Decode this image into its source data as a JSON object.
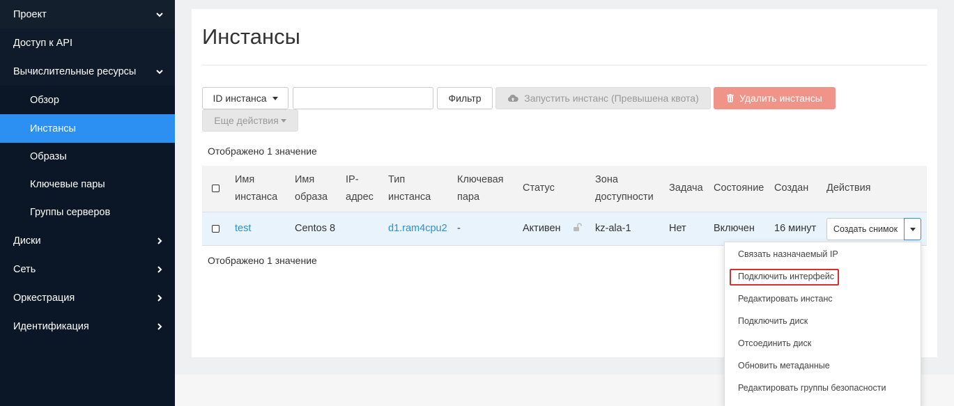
{
  "sidebar": {
    "items": [
      {
        "label": "Проект",
        "chevron": "down"
      },
      {
        "label": "Доступ к API"
      },
      {
        "label": "Вычислительные ресурсы",
        "chevron": "down"
      },
      {
        "label": "Обзор"
      },
      {
        "label": "Инстансы",
        "active": true
      },
      {
        "label": "Образы"
      },
      {
        "label": "Ключевые пары"
      },
      {
        "label": "Группы серверов"
      },
      {
        "label": "Диски",
        "chevron": "right"
      },
      {
        "label": "Сеть",
        "chevron": "right"
      },
      {
        "label": "Оркестрация",
        "chevron": "right"
      },
      {
        "label": "Идентификация",
        "chevron": "right"
      }
    ]
  },
  "page": {
    "title": "Инстансы"
  },
  "toolbar": {
    "filter_field": "ID инстанса",
    "filter_input_value": "",
    "filter_button": "Фильтр",
    "launch_button": "Запустить инстанс (Превышена квота)",
    "delete_button": "Удалить инстансы",
    "more_actions": "Еще действия",
    "launch_icon": "cloud-upload-icon",
    "delete_icon": "trash-icon"
  },
  "summary": {
    "top": "Отображено 1 значение",
    "bottom": "Отображено 1 значение"
  },
  "table": {
    "headers": {
      "name": [
        "Имя",
        "инстанса"
      ],
      "image": [
        "Имя",
        "образа"
      ],
      "ip": [
        "IP-",
        "адрес"
      ],
      "flavor": [
        "Тип",
        "инстанса"
      ],
      "keypair": [
        "Ключевая",
        "пара"
      ],
      "status": "Статус",
      "zone": [
        "Зона",
        "доступности"
      ],
      "task": "Задача",
      "power": "Состояние",
      "created": "Создан",
      "actions": "Действия"
    },
    "rows": [
      {
        "name": "test",
        "image": "Centos 8",
        "ip": "",
        "flavor": "d1.ram4cpu2",
        "keypair": "-",
        "status": "Активен",
        "status_icon": "unlock-icon",
        "zone": "kz-ala-1",
        "task": "Нет",
        "power": "Включен",
        "created": "16 минут",
        "primary_action": "Создать снимок"
      }
    ]
  },
  "dropdown": {
    "items": [
      "Связать назначаемый IP",
      "Подключить интерфейс",
      "Редактировать инстанс",
      "Подключить диск",
      "Отсоединить диск",
      "Обновить метаданные",
      "Редактировать группы безопасности"
    ],
    "highlighted_index": 1
  },
  "colors": {
    "sidebar_bg": "#0b1727",
    "active_bg": "#2c8ff2",
    "link": "#2c8fd8",
    "danger": "#f0948a",
    "highlight_border": "#d62f2f"
  }
}
